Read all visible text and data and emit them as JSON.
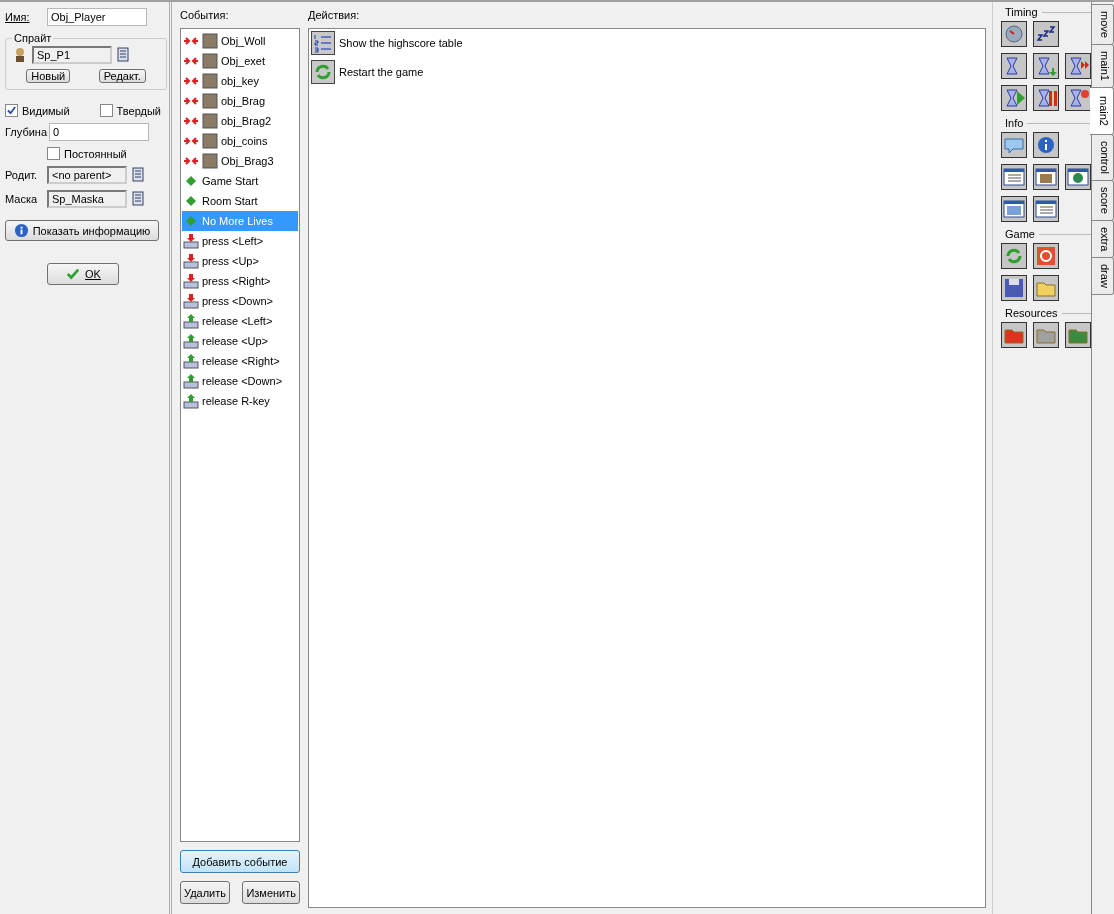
{
  "name_field": {
    "label": "Имя:",
    "value": "Obj_Player"
  },
  "sprite": {
    "legend": "Спрайт",
    "value": "Sp_P1",
    "buttons": [
      "Новый",
      "Редакт."
    ]
  },
  "checks": [
    {
      "label": "Видимый",
      "checked": true
    },
    {
      "label": "Твердый",
      "checked": false
    }
  ],
  "depth": {
    "label": "Глубина",
    "value": "0"
  },
  "persistent": {
    "label": "Постоянный",
    "checked": false
  },
  "parent": {
    "label": "Родит.",
    "value": "<no parent>"
  },
  "mask": {
    "label": "Маска",
    "value": "Sp_Maska"
  },
  "info_button": "Показать информацию",
  "ok_button": "OK",
  "events": {
    "title": "События:",
    "items": [
      {
        "kind": "collision",
        "label": "Obj_Woll",
        "selected": false
      },
      {
        "kind": "collision",
        "label": "Obj_exet",
        "selected": false
      },
      {
        "kind": "collision",
        "label": "obj_key",
        "selected": false
      },
      {
        "kind": "collision",
        "label": "obj_Brag",
        "selected": false
      },
      {
        "kind": "collision",
        "label": "obj_Brag2",
        "selected": false
      },
      {
        "kind": "collision",
        "label": "obj_coins",
        "selected": false
      },
      {
        "kind": "collision",
        "label": "Obj_Brag3",
        "selected": false
      },
      {
        "kind": "other",
        "label": "Game Start",
        "selected": false
      },
      {
        "kind": "other",
        "label": "Room Start",
        "selected": false
      },
      {
        "kind": "other",
        "label": "No More Lives",
        "selected": true
      },
      {
        "kind": "press",
        "label": "press <Left>",
        "selected": false
      },
      {
        "kind": "press",
        "label": "press <Up>",
        "selected": false
      },
      {
        "kind": "press",
        "label": "press <Right>",
        "selected": false
      },
      {
        "kind": "press",
        "label": "press <Down>",
        "selected": false
      },
      {
        "kind": "release",
        "label": "release <Left>",
        "selected": false
      },
      {
        "kind": "release",
        "label": "release <Up>",
        "selected": false
      },
      {
        "kind": "release",
        "label": "release <Right>",
        "selected": false
      },
      {
        "kind": "release",
        "label": "release <Down>",
        "selected": false
      },
      {
        "kind": "release",
        "label": "release R-key",
        "selected": false
      }
    ],
    "buttons": [
      "Добавить событие",
      "Удалить",
      "Изменить"
    ]
  },
  "actions": {
    "title": "Действия:",
    "items": [
      {
        "kind": "highscore",
        "label": "Show the highscore table"
      },
      {
        "kind": "restart",
        "label": "Restart the game"
      }
    ]
  },
  "palette": {
    "sections": [
      "Timing",
      "Info",
      "Game",
      "Resources"
    ]
  },
  "tabs": [
    {
      "label": "move",
      "selected": false
    },
    {
      "label": "main1",
      "selected": false
    },
    {
      "label": "main2",
      "selected": true
    },
    {
      "label": "control",
      "selected": false
    },
    {
      "label": "score",
      "selected": false
    },
    {
      "label": "extra",
      "selected": false
    },
    {
      "label": "draw",
      "selected": false
    }
  ]
}
